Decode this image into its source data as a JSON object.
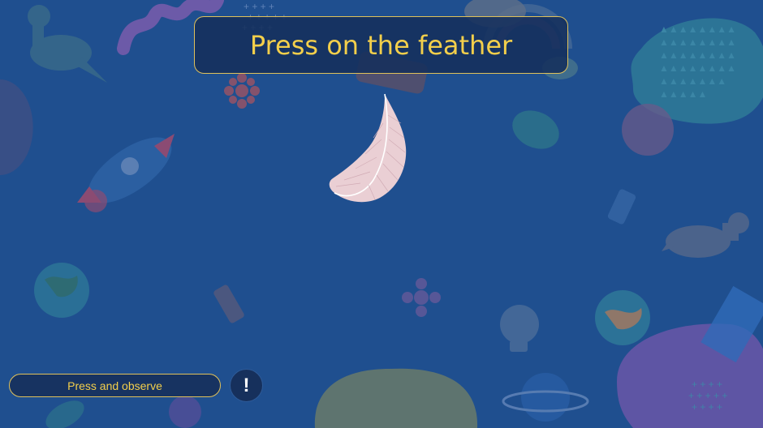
{
  "prompt": {
    "text": "Press on the feather"
  },
  "controls": {
    "hint_label": "Press and observe",
    "info_symbol": "!"
  },
  "colors": {
    "background": "#1f4f8f",
    "accent_text": "#f3cf4b",
    "border": "#e0c15a",
    "panel": "#16305c",
    "feather": "#f6d6d8"
  },
  "icons": [
    "feather-icon",
    "exclamation-icon",
    "rocket-icon",
    "dinosaur-icon",
    "planet-icon",
    "lightbulb-icon",
    "leaf-icon",
    "flower-icon",
    "globe-icon"
  ]
}
